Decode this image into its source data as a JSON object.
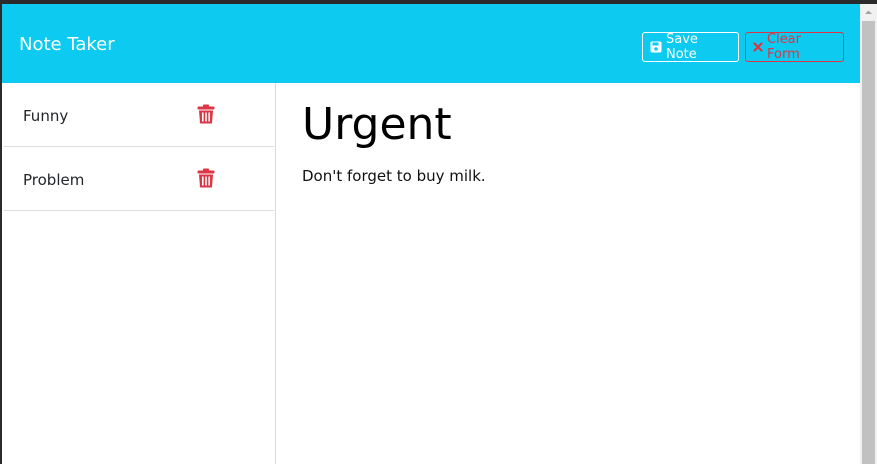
{
  "navbar": {
    "brand": "Note Taker",
    "save_label": "Save Note",
    "clear_label": "Clear Form"
  },
  "sidebar": {
    "items": [
      {
        "label": "Funny"
      },
      {
        "label": "Problem"
      }
    ]
  },
  "note": {
    "title": "Urgent",
    "body": "Don't forget to buy milk."
  },
  "colors": {
    "navbar_bg": "#0dcaf0",
    "danger": "#dc3545"
  }
}
